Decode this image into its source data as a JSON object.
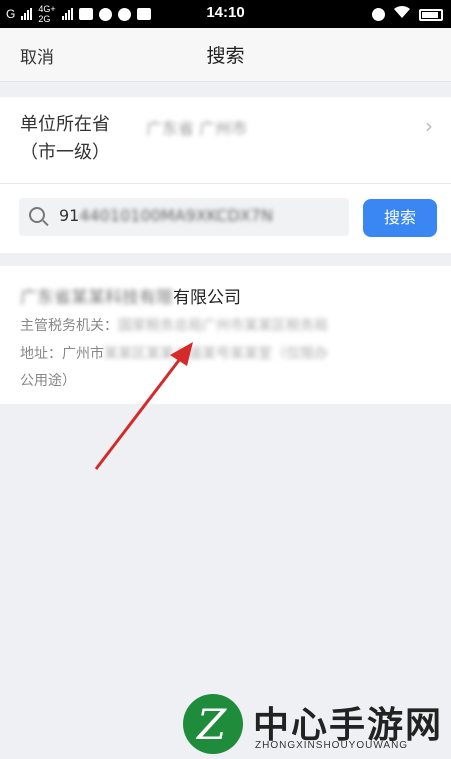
{
  "status_bar": {
    "carrier_left": "G",
    "network_top": "4G+",
    "network_bottom": "2G",
    "time": "14:10"
  },
  "nav": {
    "cancel_label": "取消",
    "title": "搜索"
  },
  "region": {
    "label": "单位所在省\n（市一级）",
    "value": "广东省 广州市"
  },
  "search": {
    "query_visible": "91",
    "query_hidden": "44010100MA9XKCDX7N",
    "button_label": "搜索"
  },
  "result": {
    "name_hidden": "广东省某某科技有限",
    "name_visible": "有限公司",
    "authority_label": "主管税务机关：",
    "authority_hidden": "国家税务总局广州市某某区税务局",
    "address_label": "地址：广州市",
    "address_hidden": "某某区某某大道某号某某室（仅限办",
    "address_tail": "公用途）"
  },
  "annotation": {
    "arrow_color": "#d42a2a"
  },
  "watermark": {
    "logo_letter": "Z",
    "title": "中心手游网",
    "subtitle": "ZHONGXINSHOUYOUWANG"
  }
}
